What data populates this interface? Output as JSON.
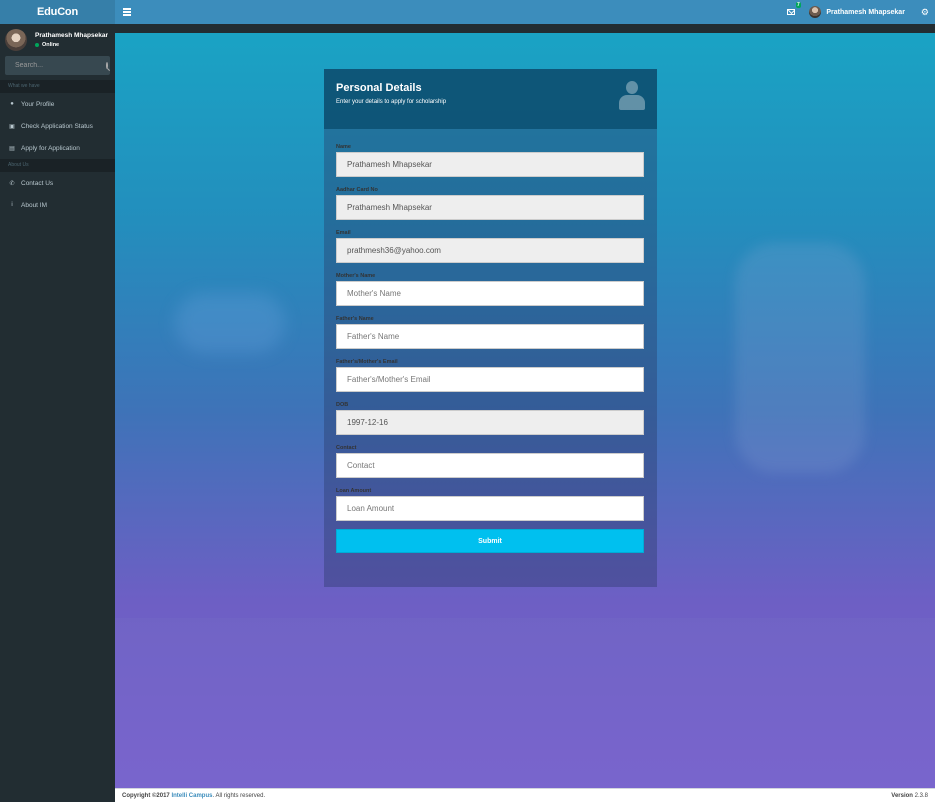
{
  "header": {
    "logo": "EduCon",
    "mail_badge": "7",
    "user_name": "Prathamesh Mhapsekar"
  },
  "sidebar": {
    "user_name": "Prathamesh Mhapsekar",
    "status": "Online",
    "search_placeholder": "Search...",
    "section1": "What we have",
    "section2": "About Us",
    "items": [
      {
        "label": "Your Profile",
        "icon": "user-icon"
      },
      {
        "label": "Check Application Status",
        "icon": "calendar-icon"
      },
      {
        "label": "Apply for Application",
        "icon": "cart-icon"
      },
      {
        "label": "Contact Us",
        "icon": "phone-icon"
      },
      {
        "label": "About IM",
        "icon": "info-icon"
      }
    ]
  },
  "form": {
    "title": "Personal Details",
    "subtitle": "Enter your details to apply for scholarship",
    "fields": [
      {
        "label": "Name",
        "value": "Prathamesh Mhapsekar",
        "placeholder": ""
      },
      {
        "label": "Aadhar Card No",
        "value": "Prathamesh Mhapsekar",
        "placeholder": ""
      },
      {
        "label": "Email",
        "value": "prathmesh36@yahoo.com",
        "placeholder": ""
      },
      {
        "label": "Mother's Name",
        "value": "",
        "placeholder": "Mother's Name"
      },
      {
        "label": "Father's Name",
        "value": "",
        "placeholder": "Father's Name"
      },
      {
        "label": "Father's/Mother's Email",
        "value": "",
        "placeholder": "Father's/Mother's Email"
      },
      {
        "label": "DOB",
        "value": "1997-12-16",
        "placeholder": ""
      },
      {
        "label": "Contact",
        "value": "",
        "placeholder": "Contact"
      },
      {
        "label": "Loan Amount",
        "value": "",
        "placeholder": "Loan Amount"
      }
    ],
    "submit_label": "Submit"
  },
  "footer": {
    "copyright_prefix": "Copyright ©2017",
    "company": "Intelli Campus",
    "rights": ". All rights reserved.",
    "version_label": "Version",
    "version": "2.3.8"
  }
}
